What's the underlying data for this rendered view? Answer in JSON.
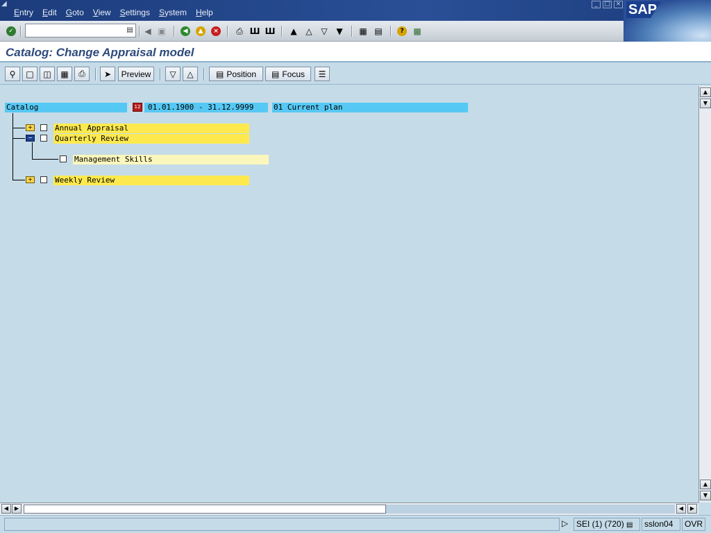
{
  "menubar": {
    "items": [
      "Entry",
      "Edit",
      "Goto",
      "View",
      "Settings",
      "System",
      "Help"
    ],
    "logo_text": "SAP"
  },
  "title": "Catalog: Change Appraisal model",
  "app_toolbar": {
    "preview_label": "Preview",
    "position_label": "Position",
    "focus_label": "Focus"
  },
  "catalog_header": {
    "label": "Catalog",
    "date_range": "01.01.1900 - 31.12.9999",
    "plan": "01 Current plan"
  },
  "tree": {
    "annual": "Annual Appraisal",
    "quarterly": "Quarterly Review",
    "management": "Management Skills",
    "weekly": "Weekly Review"
  },
  "statusbar": {
    "system": "SEI (1) (720)",
    "server": "sslon04",
    "mode": "OVR"
  },
  "colors": {
    "menubar_bg": "#1c3c7c",
    "content_bg": "#c5dbe8",
    "header_cell": "#56c8f4",
    "tree_item": "#fde94e"
  }
}
